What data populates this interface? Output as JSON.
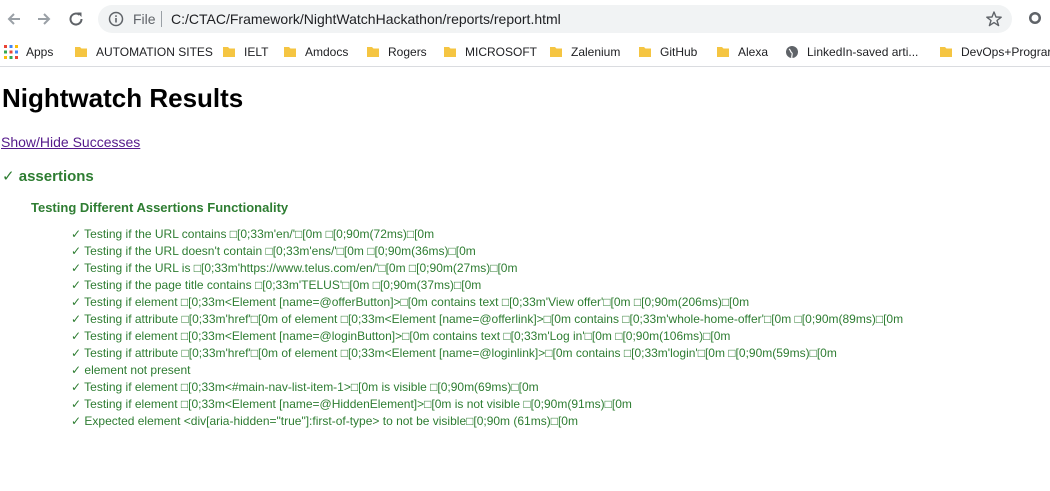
{
  "browser": {
    "scheme_label": "File",
    "url": "C:/CTAC/Framework/NightWatchHackathon/reports/report.html"
  },
  "bookmarks": {
    "apps_label": "Apps",
    "items": [
      {
        "label": "AUTOMATION SITES",
        "icon": "folder-icon"
      },
      {
        "label": "IELT",
        "icon": "folder-icon"
      },
      {
        "label": "Amdocs",
        "icon": "folder-icon"
      },
      {
        "label": "Rogers",
        "icon": "folder-icon"
      },
      {
        "label": "MICROSOFT",
        "icon": "folder-icon"
      },
      {
        "label": "Zalenium",
        "icon": "folder-icon"
      },
      {
        "label": "GitHub",
        "icon": "folder-icon"
      },
      {
        "label": "Alexa",
        "icon": "folder-icon"
      },
      {
        "label": "LinkedIn-saved arti...",
        "icon": "globe-icon"
      },
      {
        "label": "DevOps+Prograr",
        "icon": "folder-icon"
      }
    ]
  },
  "report": {
    "title": "Nightwatch Results",
    "toggle_link": "Show/Hide Successes",
    "module": "✓ assertions",
    "test_name": "Testing Different Assertions Functionality",
    "results": [
      "✓ Testing if the URL contains □[0;33m'en/'□[0m □[0;90m(72ms)□[0m",
      "✓ Testing if the URL doesn't contain □[0;33m'ens/'□[0m □[0;90m(36ms)□[0m",
      "✓ Testing if the URL is □[0;33m'https://www.telus.com/en/'□[0m □[0;90m(27ms)□[0m",
      "✓ Testing if the page title contains □[0;33m'TELUS'□[0m □[0;90m(37ms)□[0m",
      "✓ Testing if element □[0;33m<Element [name=@offerButton]>□[0m contains text □[0;33m'View offer'□[0m □[0;90m(206ms)□[0m",
      "✓ Testing if attribute □[0;33m'href'□[0m of element □[0;33m<Element [name=@offerlink]>□[0m contains □[0;33m'whole-home-offer'□[0m □[0;90m(89ms)□[0m",
      "✓ Testing if element □[0;33m<Element [name=@loginButton]>□[0m contains text □[0;33m'Log in'□[0m □[0;90m(106ms)□[0m",
      "✓ Testing if attribute □[0;33m'href'□[0m of element □[0;33m<Element [name=@loginlink]>□[0m contains □[0;33m'login'□[0m □[0;90m(59ms)□[0m",
      "✓ element not present",
      "✓ Testing if element □[0;33m<#main-nav-list-item-1>□[0m is visible □[0;90m(69ms)□[0m",
      "✓ Testing if element □[0;33m<Element [name=@HiddenElement]>□[0m is not visible □[0;90m(91ms)□[0m",
      "✓ Expected element <div[aria-hidden=\"true\"]:first-of-type> to not be visible□[0;90m (61ms)□[0m"
    ]
  },
  "colors": {
    "pass_green": "#2e7d32",
    "link_visited": "#551a8b",
    "folder_yellow": "#f5c542"
  }
}
